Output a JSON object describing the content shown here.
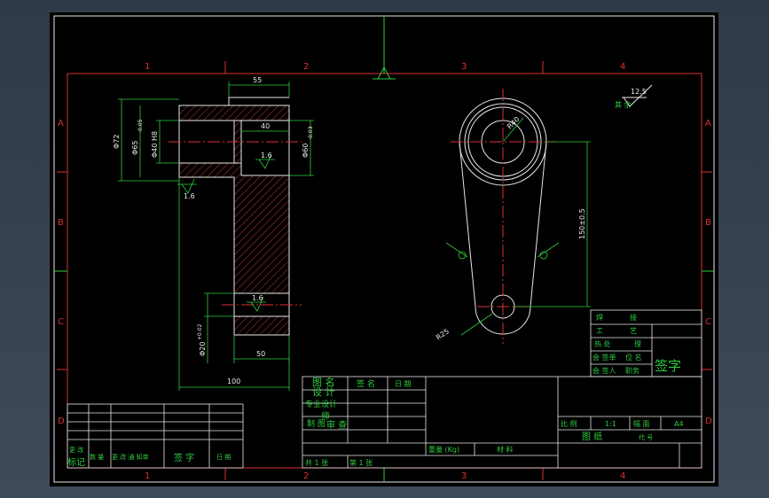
{
  "zones": {
    "columns": [
      "1",
      "2",
      "3",
      "4"
    ],
    "rows": [
      "A",
      "B",
      "C",
      "D"
    ]
  },
  "section_view": {
    "dim_top_width": "55",
    "dim_bore_depth": "40",
    "dim_outer_dia": "Φ72",
    "dim_hub_dia": "Φ65",
    "dim_hub_tol": "-0.05",
    "dim_bore": "Φ40 H8",
    "dim_right_dia": "Φ60",
    "dim_right_tol": "-0.03",
    "rough_top": "1.6",
    "rough_left": "1.6",
    "rough_bottom": "1.6",
    "dim_small_bore": "Φ20",
    "dim_small_tol": "+0.02",
    "dim_arm_width": "50",
    "dim_total": "100"
  },
  "plan_view": {
    "dim_radius_top": "R40",
    "dim_radius_bottom": "R25",
    "dim_center": "150±0.5"
  },
  "surface_note": {
    "value": "12.5",
    "label": "其 余"
  },
  "tech_box": {
    "rows": [
      {
        "a": "焊",
        "b": "接"
      },
      {
        "a": "工",
        "b": "艺"
      },
      {
        "a": "热 处",
        "b": "理"
      },
      {
        "a": "会 签单",
        "b": "位 名"
      },
      {
        "a": "会 签人",
        "b": "职务"
      }
    ],
    "signature": "签字"
  },
  "revision_table": {
    "label_a": "更 改",
    "label_b": "标记",
    "cols": [
      "数 量",
      "更 改 通 知单",
      "签 字",
      "日 期"
    ]
  },
  "title_block": {
    "designer_rows": [
      "图 名",
      "设 计",
      "专 业",
      "制 图",
      "审 查"
    ],
    "sign_header": "签 名",
    "date_header": "日 期",
    "extra_a": "专业设计",
    "extra_b": "师",
    "weight": "重量 (Kg)",
    "material": "材     料",
    "scale_label": "比 例",
    "scale_value": "1:1",
    "size_label": "幅 面",
    "size_value": "A4",
    "drawing_label": "图 纸",
    "code_label": "代 号",
    "sheets": "共 1 张",
    "sheet_no": "第 1 张"
  }
}
